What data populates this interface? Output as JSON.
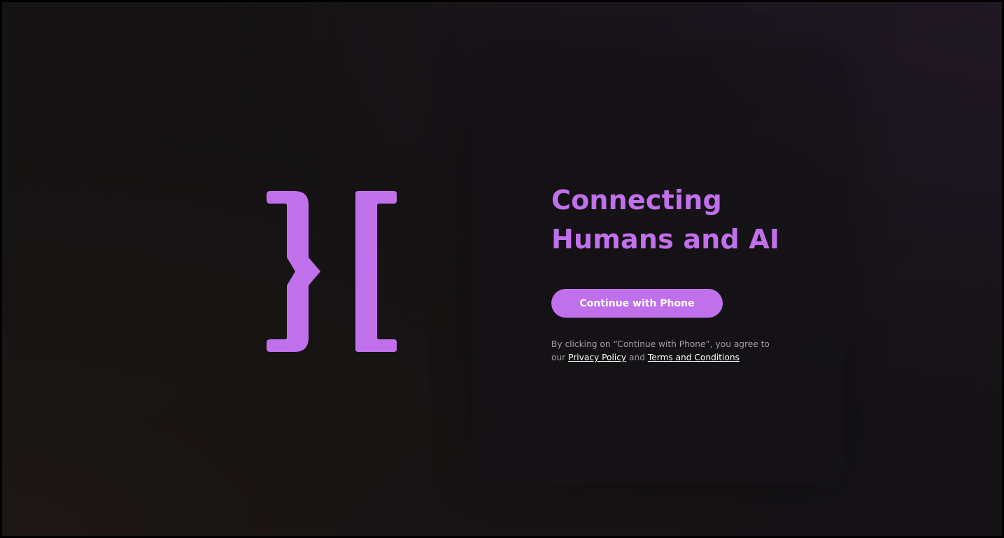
{
  "brand": {
    "logo_icon": "brace-bracket-logo-icon",
    "accent_color": "#c170ec"
  },
  "hero": {
    "headline_line1": "Connecting",
    "headline_line2": "Humans and AI"
  },
  "auth": {
    "continue_phone_label": "Continue with Phone",
    "legal_prefix": "By clicking on “Continue with Phone”, you agree to our",
    "privacy_policy_label": "Privacy Policy",
    "legal_and": "and",
    "terms_label": "Terms and Conditions"
  },
  "colors": {
    "background": "#141213",
    "panel": "#19161a",
    "text_muted": "#a39fa4",
    "link": "#ffffff"
  }
}
